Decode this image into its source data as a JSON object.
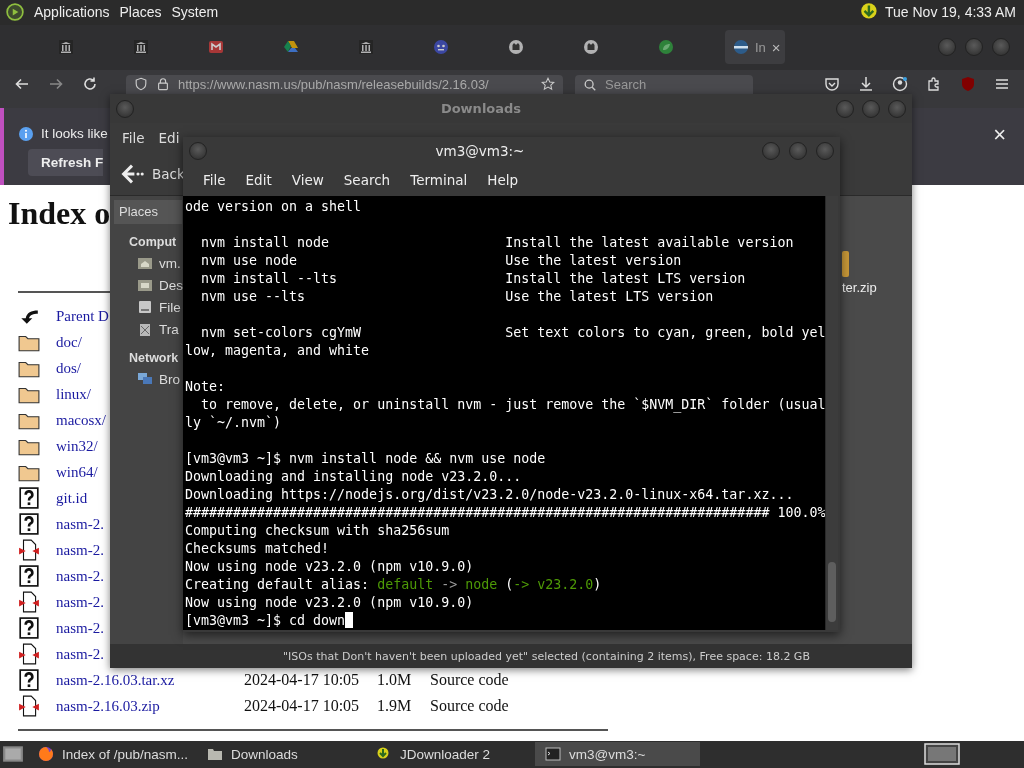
{
  "top_panel": {
    "menus": [
      "Applications",
      "Places",
      "System"
    ],
    "clock": "Tue Nov 19, 4:33 AM"
  },
  "browser": {
    "tabs": [
      {
        "kind": "bank",
        "selected": false
      },
      {
        "kind": "bank",
        "selected": false
      },
      {
        "kind": "mail",
        "selected": false
      },
      {
        "kind": "drive",
        "selected": false
      },
      {
        "kind": "bank",
        "selected": false
      },
      {
        "kind": "bot",
        "selected": false
      },
      {
        "kind": "cat",
        "selected": false
      },
      {
        "kind": "cat",
        "selected": false
      },
      {
        "kind": "leaf",
        "selected": false
      },
      {
        "kind": "globe",
        "label": "In",
        "close": "×",
        "selected": true
      }
    ],
    "toolbar": {
      "url": "https://www.nasm.us/pub/nasm/releasebuilds/2.16.03/",
      "search": {
        "placeholder": "Search"
      }
    },
    "notification": {
      "message": "It looks like",
      "button": "Refresh F",
      "close": "×"
    },
    "page": {
      "heading": "Index o",
      "rows": [
        {
          "kind": "parent",
          "name": "Parent D"
        },
        {
          "kind": "folder",
          "name": "doc/"
        },
        {
          "kind": "folder",
          "name": "dos/"
        },
        {
          "kind": "folder",
          "name": "linux/"
        },
        {
          "kind": "folder",
          "name": "macosx/"
        },
        {
          "kind": "folder",
          "name": "win32/"
        },
        {
          "kind": "folder",
          "name": "win64/"
        },
        {
          "kind": "unknown",
          "name": "git.id"
        },
        {
          "kind": "unknown",
          "name": "nasm-2."
        },
        {
          "kind": "compressed",
          "name": "nasm-2."
        },
        {
          "kind": "unknown",
          "name": "nasm-2."
        },
        {
          "kind": "compressed",
          "name": "nasm-2."
        },
        {
          "kind": "unknown",
          "name": "nasm-2."
        },
        {
          "kind": "compressed",
          "name": "nasm-2."
        },
        {
          "kind": "unknown",
          "name": "nasm-2.16.03.tar.xz",
          "date": "2024-04-17 10:05",
          "size": "1.0M",
          "description": "Source code"
        },
        {
          "kind": "compressed",
          "name": "nasm-2.16.03.zip",
          "date": "2024-04-17 10:05",
          "size": "1.9M",
          "description": "Source code"
        }
      ]
    }
  },
  "file_manager": {
    "title": "Downloads",
    "menus": [
      "File",
      "Edi"
    ],
    "back": "Back",
    "sidebar": {
      "tab": "Places",
      "sections": [
        {
          "heading": "Comput",
          "items": [
            {
              "kind": "home",
              "label": "vm."
            },
            {
              "kind": "desktop",
              "label": "Des"
            },
            {
              "kind": "drive",
              "label": "File"
            },
            {
              "kind": "trash",
              "label": "Tra"
            }
          ]
        },
        {
          "heading": "Network",
          "items": [
            {
              "kind": "network",
              "label": "Bro"
            }
          ]
        }
      ]
    },
    "files": [
      {
        "kind": "archive",
        "name": "ter.zip"
      }
    ],
    "status": "\"ISOs that Don't haven't been uploaded yet\" selected (containing 2 items), Free space: 18.2 GB"
  },
  "terminal": {
    "title": "vm3@vm3:~",
    "menus": [
      "File",
      "Edit",
      "View",
      "Search",
      "Terminal",
      "Help"
    ],
    "paragraphs": [
      [
        {
          "text": "ode version on a shell"
        }
      ],
      [
        {
          "text": "  nvm install node                      Install the latest available version"
        },
        {
          "text": "  nvm use node                          Use the latest version"
        },
        {
          "text": "  nvm install --lts                     Install the latest LTS version"
        },
        {
          "text": "  nvm use --lts                         Use the latest LTS version"
        }
      ],
      [
        {
          "text": "  nvm set-colors cgYmW                  Set text colors to cyan, green, bold yel"
        },
        {
          "text": "low, magenta, and white"
        }
      ],
      [
        {
          "text": "Note:"
        },
        {
          "text": "  to remove, delete, or uninstall nvm - just remove the `$NVM_DIR` folder (usual"
        },
        {
          "text": "ly `~/.nvm`)"
        }
      ],
      [
        {
          "text": "[vm3@vm3 ~]$ nvm install node && nvm use node"
        },
        {
          "text": "Downloading and installing node v23.2.0..."
        },
        {
          "text": "Downloading https://nodejs.org/dist/v23.2.0/node-v23.2.0-linux-x64.tar.xz..."
        },
        {
          "text": "######################################################################### 100.0%"
        },
        {
          "text": "Computing checksum with sha256sum"
        },
        {
          "text": "Checksums matched!"
        },
        {
          "text": "Now using node v23.2.0 (npm v10.9.0)"
        },
        {
          "segments": [
            {
              "text": "Creating default alias: ",
              "color": "#ffffff"
            },
            {
              "text": "default",
              "color": "#4e9a06"
            },
            {
              "text": " -> ",
              "color": "#9a9a9a"
            },
            {
              "text": "node",
              "color": "#4e9a06"
            },
            {
              "text": " (",
              "color": "#ffffff"
            },
            {
              "text": "-> v23.2.0",
              "color": "#4e9a06"
            },
            {
              "text": ")",
              "color": "#ffffff"
            }
          ]
        },
        {
          "text": "Now using node v23.2.0 (npm v10.9.0)"
        },
        {
          "text": "[vm3@vm3 ~]$ cd down",
          "cursor": true
        }
      ]
    ]
  },
  "taskbar": {
    "items": [
      {
        "kind": "firefox",
        "label": "Index of /pub/nasm...",
        "selected": false
      },
      {
        "kind": "folder",
        "label": "Downloads",
        "selected": false
      },
      {
        "kind": "jdownloader",
        "label": "JDownloader 2",
        "selected": false
      },
      {
        "kind": "terminal",
        "label": "vm3@vm3:~",
        "selected": true
      }
    ]
  }
}
